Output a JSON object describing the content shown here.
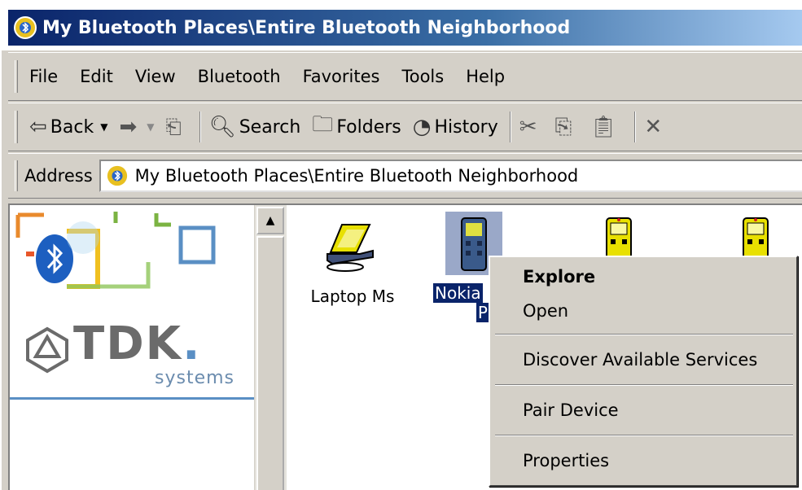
{
  "window": {
    "title": "My Bluetooth Places\\Entire Bluetooth Neighborhood"
  },
  "menubar": {
    "items": [
      "File",
      "Edit",
      "View",
      "Bluetooth",
      "Favorites",
      "Tools",
      "Help"
    ]
  },
  "toolbar": {
    "back_label": "Back",
    "search_label": "Search",
    "folders_label": "Folders",
    "history_label": "History"
  },
  "addressbar": {
    "label": "Address",
    "value": "My Bluetooth Places\\Entire Bluetooth Neighborhood"
  },
  "leftpane": {
    "brand": "TDK",
    "brand_suffix": ".",
    "brand_sub": "systems"
  },
  "devices": [
    {
      "label": "Laptop Ms",
      "icon": "laptop-icon"
    },
    {
      "label_line1": "Nokia",
      "label_line2": "PK",
      "icon": "phone-icon",
      "selected": true
    },
    {
      "label": "",
      "icon": "phone-icon"
    },
    {
      "label": "",
      "icon": "phone-icon"
    }
  ],
  "context_menu": {
    "items": [
      "Explore",
      "Open",
      "Discover Available Services",
      "Pair Device",
      "Properties"
    ],
    "default_item": "Explore"
  },
  "colors": {
    "title_gradient_start": "#0a246a",
    "title_gradient_end": "#a6caf0",
    "selection": "#0a246a",
    "chrome": "#d4d0c8"
  }
}
